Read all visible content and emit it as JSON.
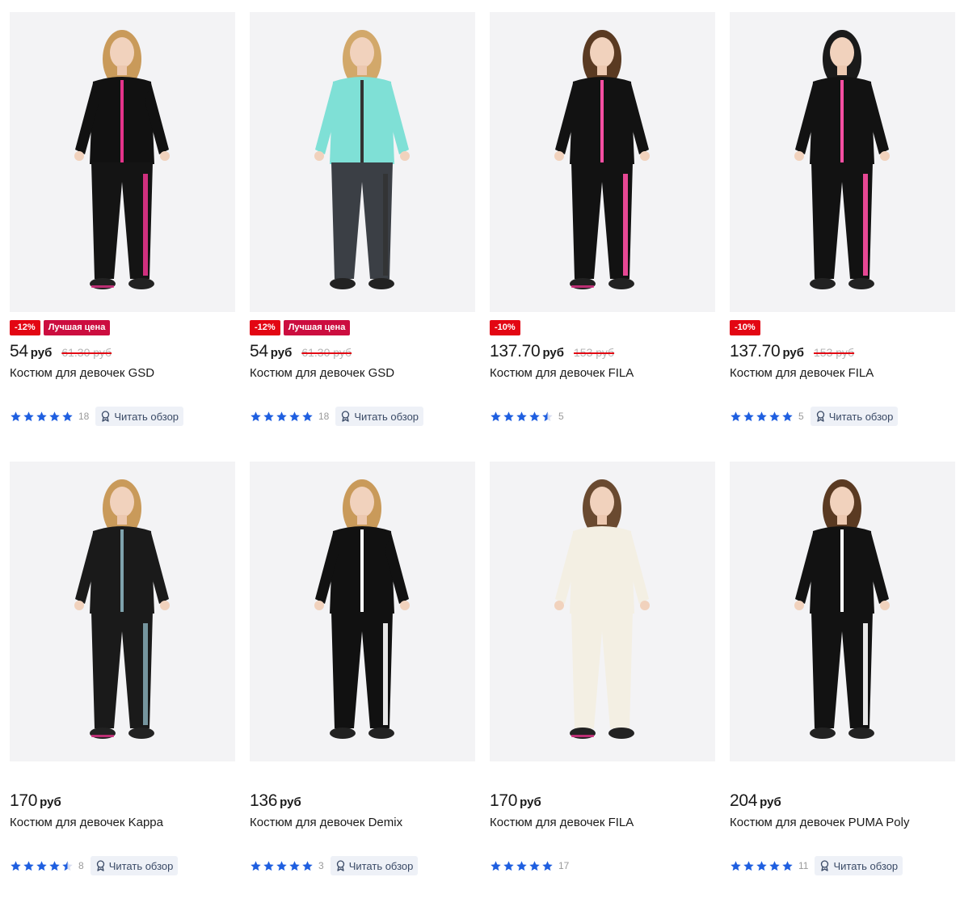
{
  "currency": "руб",
  "review_label": "Читать обзор",
  "colors": {
    "star": "#1f5fe0",
    "discount_badge": "#e30613",
    "best_price_badge": "#cc0d3f",
    "photo_bg": "#f3f3f5"
  },
  "products": [
    {
      "price": "54",
      "old_price": "61.30 руб",
      "badges": [
        "-12%",
        "Лучшая цена"
      ],
      "title": "Костюм для девочек GSD",
      "rating": 5,
      "reviews": "18",
      "has_review_button": true,
      "outfit": {
        "top": "#111111",
        "accent": "#e4338a",
        "pants": "#141414",
        "hair": "#c99a5a"
      }
    },
    {
      "price": "54",
      "old_price": "61.30 руб",
      "badges": [
        "-12%",
        "Лучшая цена"
      ],
      "title": "Костюм для девочек GSD",
      "rating": 5,
      "reviews": "18",
      "has_review_button": true,
      "outfit": {
        "top": "#7fe0d6",
        "accent": "#333333",
        "pants": "#3b3f45",
        "hair": "#d2a86a"
      }
    },
    {
      "price": "137.70",
      "old_price": "153 руб",
      "badges": [
        "-10%"
      ],
      "title": "Костюм для девочек FILA",
      "rating": 4.5,
      "reviews": "5",
      "has_review_button": false,
      "outfit": {
        "top": "#121212",
        "accent": "#ff4fa3",
        "pants": "#121212",
        "hair": "#5a3a22"
      }
    },
    {
      "price": "137.70",
      "old_price": "153 руб",
      "badges": [
        "-10%"
      ],
      "title": "Костюм для девочек FILA",
      "rating": 5,
      "reviews": "5",
      "has_review_button": true,
      "outfit": {
        "top": "#121212",
        "accent": "#ff4fa3",
        "pants": "#121212",
        "hair": "#1a1a1a"
      }
    },
    {
      "price": "170",
      "old_price": "",
      "badges": [],
      "title": "Костюм для девочек Kappa",
      "rating": 4.5,
      "reviews": "8",
      "has_review_button": true,
      "outfit": {
        "top": "#1a1a1a",
        "accent": "#7fa3ad",
        "pants": "#1a1a1a",
        "hair": "#c99a5a"
      }
    },
    {
      "price": "136",
      "old_price": "",
      "badges": [],
      "title": "Костюм для девочек Demix",
      "rating": 5,
      "reviews": "3",
      "has_review_button": true,
      "outfit": {
        "top": "#111111",
        "accent": "#ffffff",
        "pants": "#111111",
        "hair": "#c99a5a"
      }
    },
    {
      "price": "170",
      "old_price": "",
      "badges": [],
      "title": "Костюм для девочек FILA",
      "rating": 5,
      "reviews": "17",
      "has_review_button": false,
      "outfit": {
        "top": "#f3efe3",
        "accent": "#f3efe3",
        "pants": "#f3efe3",
        "hair": "#6a4a30"
      }
    },
    {
      "price": "204",
      "old_price": "",
      "badges": [],
      "title": "Костюм для девочек PUMA Poly",
      "rating": 5,
      "reviews": "11",
      "has_review_button": true,
      "outfit": {
        "top": "#121212",
        "accent": "#ffffff",
        "pants": "#121212",
        "hair": "#5a3a22"
      }
    }
  ]
}
